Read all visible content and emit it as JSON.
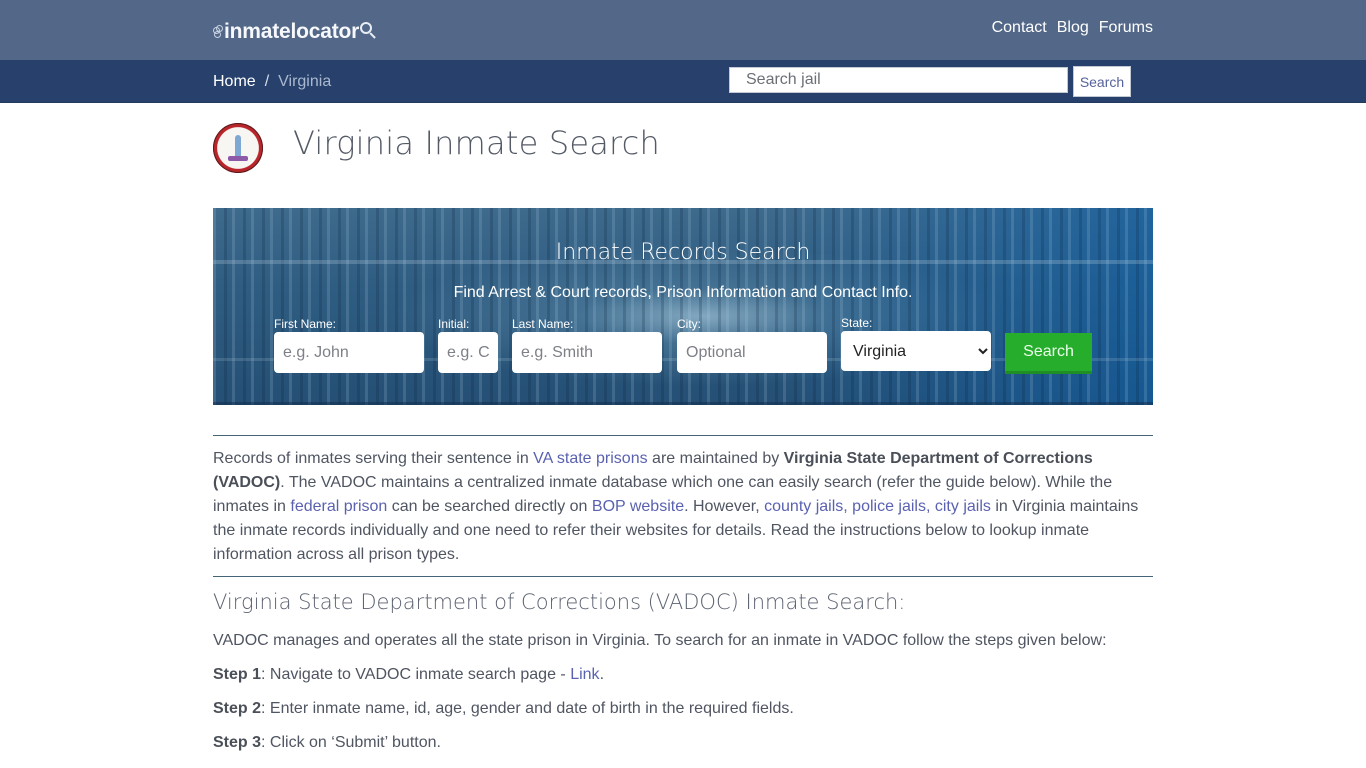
{
  "header": {
    "logo_text": "inmatelocator",
    "nav": [
      {
        "label": "Contact"
      },
      {
        "label": "Blog"
      },
      {
        "label": "Forums"
      }
    ]
  },
  "subbar": {
    "breadcrumb": {
      "home": "Home",
      "separator": "/",
      "current": "Virginia"
    },
    "jail_search": {
      "placeholder": "Search jail",
      "value": "",
      "button_label": "Search"
    }
  },
  "page": {
    "title": "Virginia Inmate Search",
    "seal_alt": "virginia-state-seal"
  },
  "hero": {
    "heading": "Inmate Records Search",
    "tagline": "Find Arrest & Court records, Prison Information and Contact Info.",
    "fields": {
      "first_name": {
        "label": "First Name:",
        "placeholder": "e.g. John"
      },
      "initial": {
        "label": "Initial:",
        "placeholder": "e.g. C"
      },
      "last_name": {
        "label": "Last Name:",
        "placeholder": "e.g. Smith"
      },
      "city": {
        "label": "City:",
        "placeholder": "Optional"
      },
      "state": {
        "label": "State:",
        "selected": "Virginia"
      }
    },
    "search_label": "Search",
    "colors": {
      "search_button": "#27ad2c"
    }
  },
  "intro": {
    "t1": "Records of inmates serving their sentence in ",
    "link_va_prisons": "VA state prisons",
    "t2": " are maintained by ",
    "bold_vadoc": "Virginia State Department of Corrections (VADOC)",
    "t3": ". The VADOC maintains a centralized inmate database which one can easily search (refer the guide below). While the inmates in ",
    "link_federal": "federal prison",
    "t4": " can be searched directly on ",
    "link_bop": "BOP website",
    "t5": ". However, ",
    "link_jails": "county jails, police jails, city jails",
    "t6": " in Virginia maintains the inmate records individually and one need to refer their websites for details. Read the instructions below to lookup inmate information across all prison types."
  },
  "vadoc_section": {
    "title": "Virginia State Department of Corrections (VADOC) Inmate Search:",
    "description": "VADOC manages and operates all the state prison in Virginia. To search for an inmate in VADOC follow the steps given below:",
    "steps": [
      {
        "label": "Step 1",
        "text": ": Navigate to VADOC inmate search page - ",
        "link": "Link",
        "after": "."
      },
      {
        "label": "Step 2",
        "text": ": Enter inmate name, id, age, gender and date of birth in the required fields."
      },
      {
        "label": "Step 3",
        "text": ": Click on ‘Submit’ button."
      }
    ]
  },
  "colors": {
    "topbar": "#536888",
    "subbar": "#27416c",
    "link": "#5a62b0",
    "divider": "#456576"
  }
}
